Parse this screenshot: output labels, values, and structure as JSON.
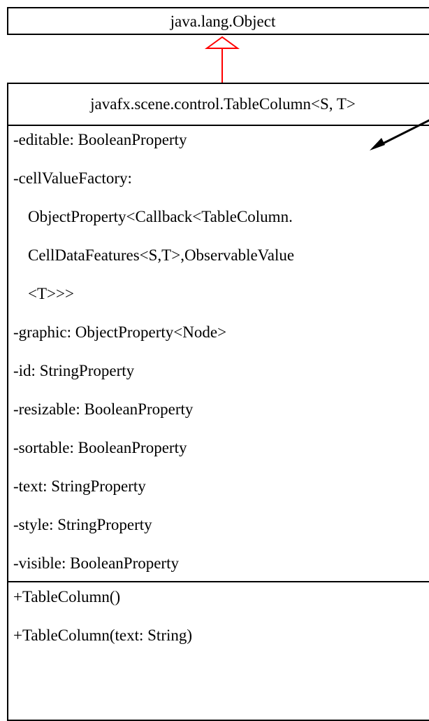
{
  "superclass": {
    "name": "java.lang.Object"
  },
  "class": {
    "name": "javafx.scene.control.TableColumn<S, T>",
    "properties": [
      "-editable: BooleanProperty",
      "-cellValueFactory:",
      "ObjectProperty<Callback<TableColumn.",
      "CellDataFeatures<S,T>,ObservableValue",
      "<T>>>",
      "-graphic: ObjectProperty<Node>",
      "-id: StringProperty",
      "-resizable: BooleanProperty",
      "-sortable: BooleanProperty",
      "-text: StringProperty",
      "-style: StringProperty",
      "-visible: BooleanProperty"
    ],
    "methods": [
      "+TableColumn()",
      "+TableColumn(text: String)"
    ]
  },
  "colors": {
    "inheritance_arrow": "#ff0000",
    "note_arrow": "#000000"
  }
}
